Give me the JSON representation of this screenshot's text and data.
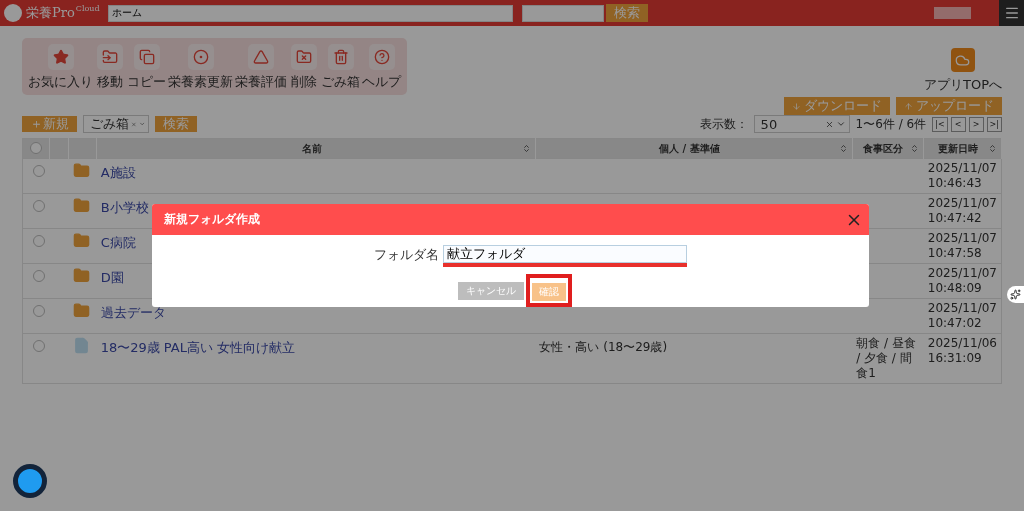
{
  "header": {
    "logo": "栄養Pro",
    "logo_sup": "Cloud",
    "path_field": "ホーム",
    "search_button": "検索"
  },
  "toolbar": [
    {
      "kind": "favorite",
      "label": "お気に入り"
    },
    {
      "kind": "move",
      "label": "移動"
    },
    {
      "kind": "copy",
      "label": "コピー"
    },
    {
      "kind": "update",
      "label": "栄養素更新"
    },
    {
      "kind": "evaluate",
      "label": "栄養評価"
    },
    {
      "kind": "delete",
      "label": "削除"
    },
    {
      "kind": "trash",
      "label": "ごみ箱"
    },
    {
      "kind": "help",
      "label": "ヘルプ"
    }
  ],
  "app_top": "アプリTOPへ",
  "download_button": "ダウンロード",
  "upload_button": "アップロード",
  "new_button": "＋新規",
  "filter": {
    "value": "ごみ箱",
    "search_button": "検索"
  },
  "pager": {
    "label": "表示数：",
    "per_page": "50",
    "range": "1〜6件 / 6件",
    "buttons": [
      "|<",
      "<",
      ">",
      ">|"
    ]
  },
  "table": {
    "select_all": {
      "checked": false
    },
    "columns": [
      {
        "label": "名前",
        "sortable": true
      },
      {
        "label": "個人 / 基準値",
        "sortable": true
      },
      {
        "label": "食事区分",
        "sortable": true
      },
      {
        "label": "更新日時",
        "sortable": true
      }
    ],
    "rows": [
      {
        "kind": "folder",
        "selected": false,
        "name": "A施設",
        "standard": "",
        "meal": "",
        "date": "2025/11/07",
        "time": "10:46:43"
      },
      {
        "kind": "folder",
        "selected": false,
        "name": "B小学校",
        "standard": "",
        "meal": "",
        "date": "2025/11/07",
        "time": "10:47:42"
      },
      {
        "kind": "folder",
        "selected": false,
        "name": "C病院",
        "standard": "",
        "meal": "",
        "date": "2025/11/07",
        "time": "10:47:58"
      },
      {
        "kind": "folder",
        "selected": false,
        "name": "D園",
        "standard": "",
        "meal": "",
        "date": "2025/11/07",
        "time": "10:48:09"
      },
      {
        "kind": "folder",
        "selected": false,
        "name": "過去データ",
        "standard": "",
        "meal": "",
        "date": "2025/11/07",
        "time": "10:47:02"
      },
      {
        "kind": "file",
        "selected": false,
        "name": "18〜29歳 PAL高い 女性向け献立",
        "standard": "女性・高い (18〜29歳)",
        "meal": "朝食 / 昼食 / 夕食 / 間食1",
        "date": "2025/11/06",
        "time": "16:31:09"
      }
    ]
  },
  "modal": {
    "title": "新規フォルダ作成",
    "field_label": "フォルダ名",
    "field_value": "献立フォルダ",
    "field_highlighted": true,
    "cancel_button": "キャンセル",
    "confirm_button": "確認",
    "confirm_highlighted": true
  }
}
